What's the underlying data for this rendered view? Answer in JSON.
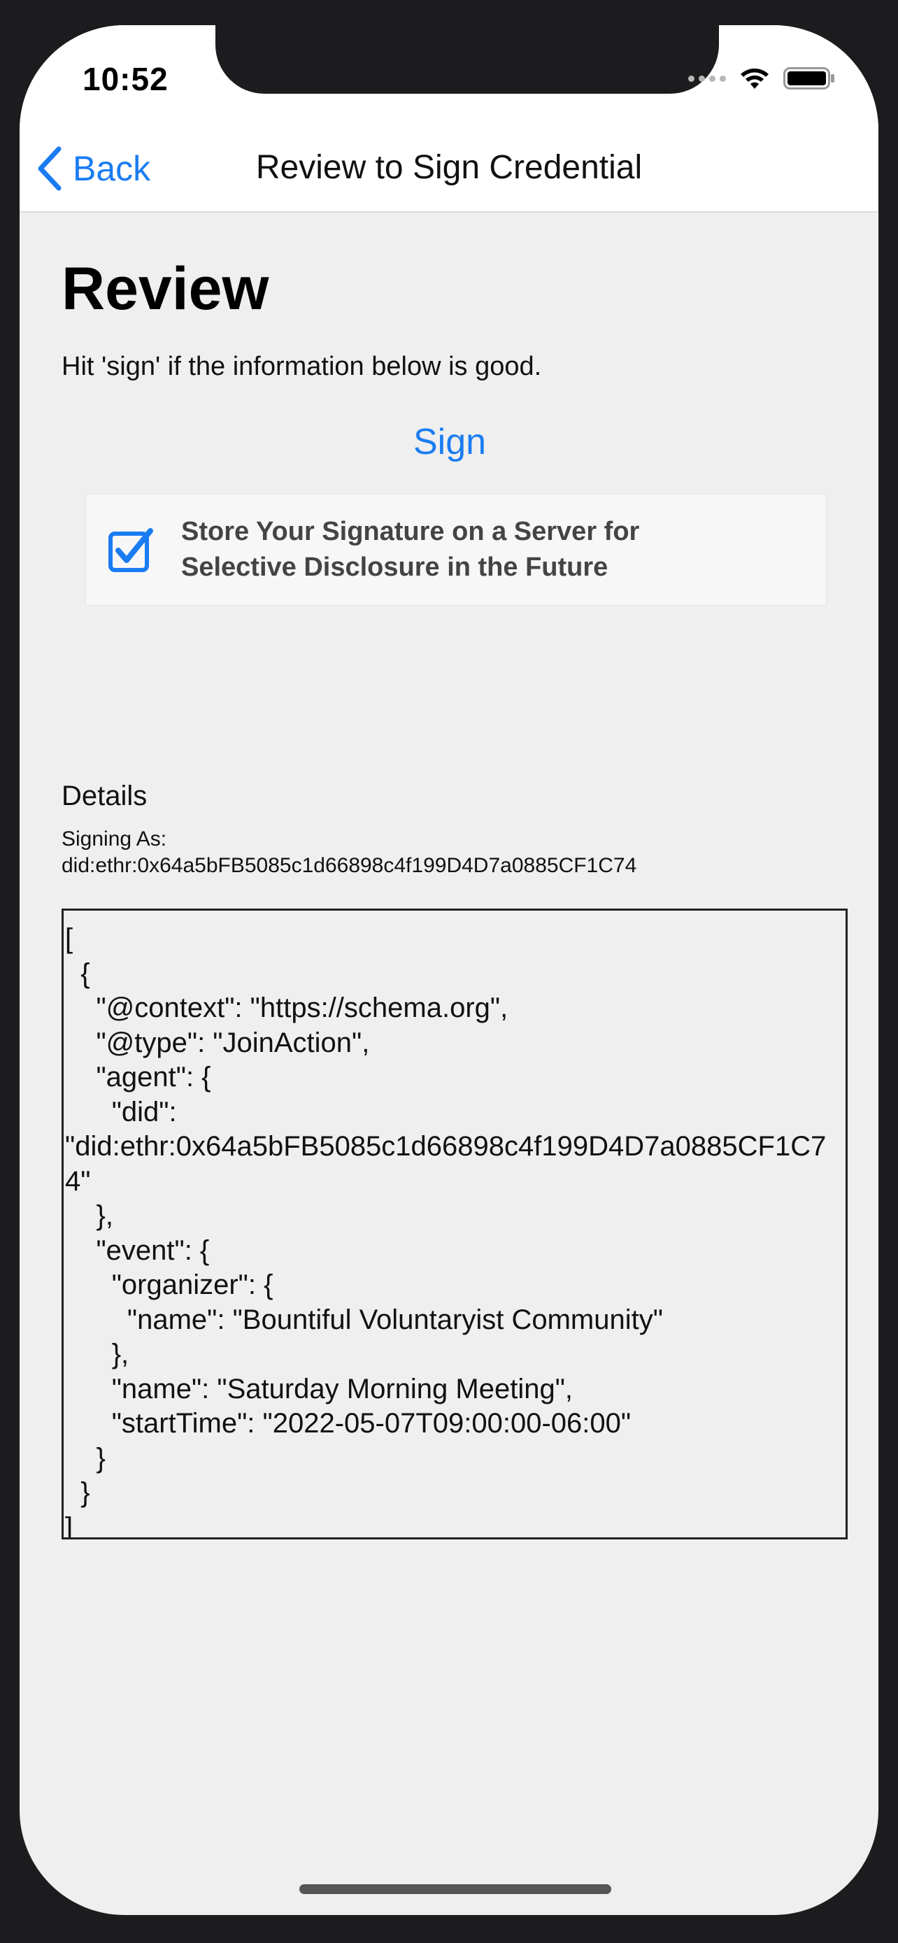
{
  "status_bar": {
    "time": "10:52"
  },
  "nav": {
    "back_label": "Back",
    "title": "Review to Sign Credential"
  },
  "review": {
    "heading": "Review",
    "subtitle": "Hit 'sign' if the information below is good.",
    "sign_label": "Sign",
    "store_checkbox": {
      "label_line1": "Store Your Signature on a Server for",
      "label_line2": "Selective Disclosure in the Future",
      "checked": "true"
    }
  },
  "details": {
    "label": "Details",
    "signing_as_label": "Signing As:",
    "signing_as_did": "did:ethr:0x64a5bFB5085c1d66898c4f199D4D7a0885CF1C74",
    "json_text": "[\n  {\n    \"@context\": \"https://schema.org\",\n    \"@type\": \"JoinAction\",\n    \"agent\": {\n      \"did\":\n\"did:ethr:0x64a5bFB5085c1d66898c4f199D4D7a0885CF1C74\"\n    },\n    \"event\": {\n      \"organizer\": {\n        \"name\": \"Bountiful Voluntaryist Community\"\n      },\n      \"name\": \"Saturday Morning Meeting\",\n      \"startTime\": \"2022-05-07T09:00:00-06:00\"\n    }\n  }\n]"
  },
  "colors": {
    "accent": "#1a7cf2",
    "background": "#efefef",
    "nav_background": "#ffffff"
  },
  "icons": {
    "back": "chevron-left-icon",
    "checkbox": "checkbox-checked-icon",
    "wifi": "wifi-icon",
    "battery": "battery-icon",
    "signal": "cellular-signal-icon"
  }
}
